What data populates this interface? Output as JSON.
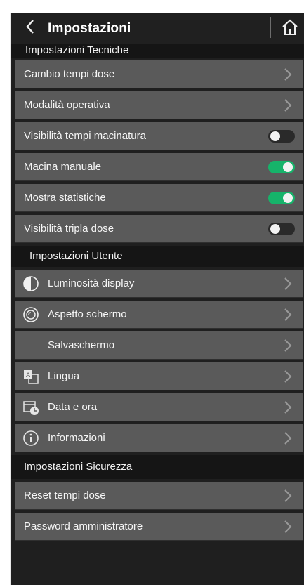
{
  "header": {
    "title": "Impostazioni"
  },
  "sections": {
    "tecniche": "Impostazioni Tecniche",
    "utente": "Impostazioni Utente",
    "sicurezza": "Impostazioni Sicurezza"
  },
  "tecniche_rows": [
    {
      "label": "Cambio tempi dose",
      "control": "chevron"
    },
    {
      "label": "Modalità operativa",
      "control": "chevron"
    },
    {
      "label": "Visibilità tempi macinatura",
      "control": "toggle",
      "on": false
    },
    {
      "label": "Macina manuale",
      "control": "toggle",
      "on": true
    },
    {
      "label": "Mostra statistiche",
      "control": "toggle",
      "on": true
    },
    {
      "label": "Visibilità tripla dose",
      "control": "toggle",
      "on": false
    }
  ],
  "utente_rows": [
    {
      "label": "Luminosità display",
      "icon": "brightness-icon"
    },
    {
      "label": "Aspetto schermo",
      "icon": "appearance-icon"
    },
    {
      "label": "Salvaschermo",
      "icon": "screensaver-moon-icon"
    },
    {
      "label": "Lingua",
      "icon": "language-icon"
    },
    {
      "label": "Data e ora",
      "icon": "calendar-clock-icon"
    },
    {
      "label": "Informazioni",
      "icon": "info-icon"
    }
  ],
  "sicurezza_rows": [
    {
      "label": "Reset tempi dose"
    },
    {
      "label": "Password amministratore"
    }
  ],
  "colors": {
    "toggle_on": "#16b36a",
    "row_bg": "#5a5a5a",
    "background": "#1f1f1f"
  }
}
